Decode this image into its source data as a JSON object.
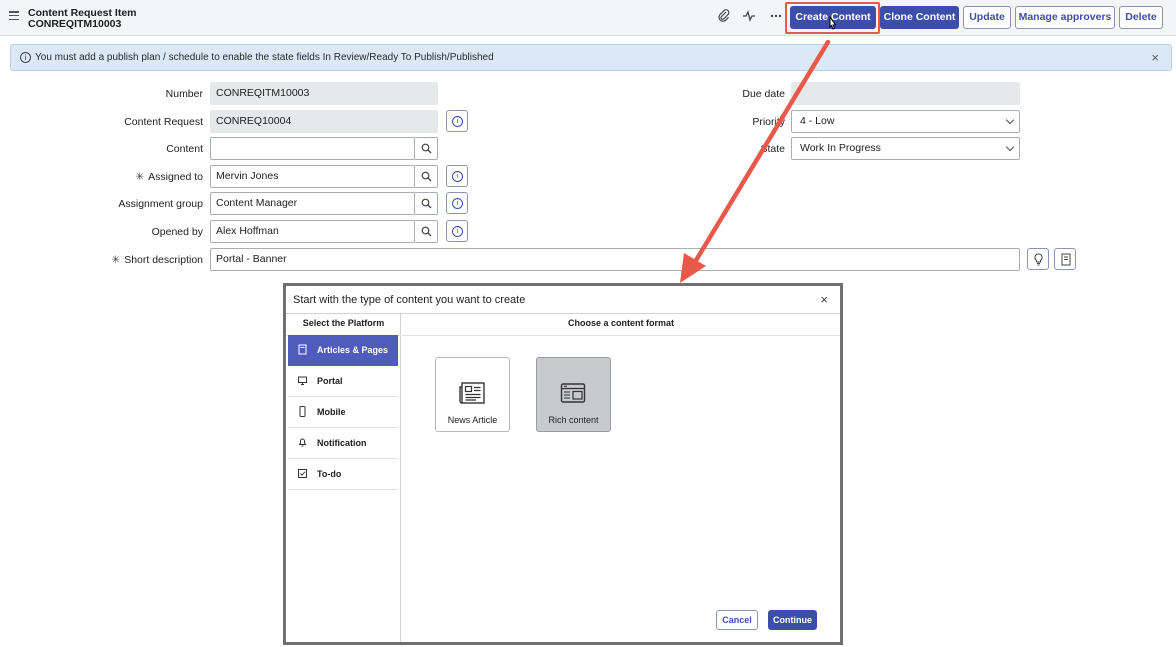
{
  "header": {
    "record_type": "Content Request Item",
    "record_number": "CONREQITM10003",
    "icons": [
      "paperclip-icon",
      "activity-icon",
      "more-icon",
      "menu-icon"
    ],
    "buttons": {
      "create_content": "Create Content",
      "clone_content": "Clone Content",
      "update": "Update",
      "manage_approvers": "Manage approvers",
      "delete": "Delete"
    }
  },
  "banner": {
    "message": "You must add a publish plan / schedule to enable the state fields In Review/Ready To Publish/Published",
    "close": "×"
  },
  "form": {
    "number": {
      "label": "Number",
      "value": "CONREQITM10003"
    },
    "content_request": {
      "label": "Content Request",
      "value": "CONREQ10004"
    },
    "content": {
      "label": "Content",
      "value": ""
    },
    "assigned_to": {
      "label": "Assigned to",
      "value": "Mervin Jones",
      "required": "✳"
    },
    "assignment_group": {
      "label": "Assignment group",
      "value": "Content Manager"
    },
    "opened_by": {
      "label": "Opened by",
      "value": "Alex Hoffman"
    },
    "short_description": {
      "label": "Short description",
      "value": "Portal - Banner",
      "required": "✳"
    },
    "due_date": {
      "label": "Due date",
      "value": ""
    },
    "priority": {
      "label": "Priority",
      "value": "4 - Low"
    },
    "state": {
      "label": "State",
      "value": "Work In Progress"
    }
  },
  "modal": {
    "title": "Start with the type of content you want to create",
    "close": "×",
    "platform_header": "Select the Platform",
    "format_header": "Choose a content format",
    "platforms": [
      {
        "label": "Articles & Pages",
        "icon": "document-icon",
        "active": true
      },
      {
        "label": "Portal",
        "icon": "monitor-icon",
        "active": false
      },
      {
        "label": "Mobile",
        "icon": "mobile-icon",
        "active": false
      },
      {
        "label": "Notification",
        "icon": "bell-icon",
        "active": false
      },
      {
        "label": "To-do",
        "icon": "checkbox-icon",
        "active": false
      }
    ],
    "formats": [
      {
        "label": "News Article",
        "icon": "newspaper-icon",
        "selected": false
      },
      {
        "label": "Rich content",
        "icon": "rich-content-icon",
        "selected": true
      }
    ],
    "cancel": "Cancel",
    "continue": "Continue"
  },
  "colors": {
    "primary": "#3c4ea8",
    "active_nav": "#4f5bbd",
    "annotation": "#e8594a",
    "banner": "#dbe8f6"
  }
}
